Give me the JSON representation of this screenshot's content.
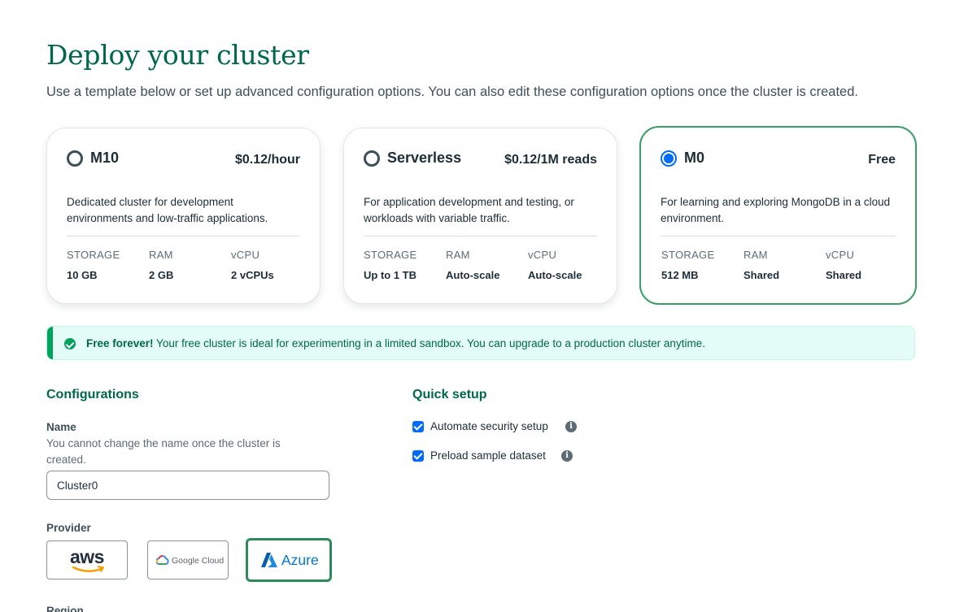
{
  "header": {
    "title": "Deploy your cluster",
    "subtitle": "Use a template below or set up advanced configuration options. You can also edit these configuration options once the cluster is created."
  },
  "tiers": [
    {
      "name": "M10",
      "price": "$0.12/hour",
      "selected": false,
      "description": "Dedicated cluster for development environments and low-traffic applications.",
      "specs": [
        {
          "label": "STORAGE",
          "value": "10 GB"
        },
        {
          "label": "RAM",
          "value": "2 GB"
        },
        {
          "label": "vCPU",
          "value": "2 vCPUs"
        }
      ]
    },
    {
      "name": "Serverless",
      "price": "$0.12/1M reads",
      "selected": false,
      "description": "For application development and testing, or workloads with variable traffic.",
      "specs": [
        {
          "label": "STORAGE",
          "value": "Up to 1 TB"
        },
        {
          "label": "RAM",
          "value": "Auto-scale"
        },
        {
          "label": "vCPU",
          "value": "Auto-scale"
        }
      ]
    },
    {
      "name": "M0",
      "price": "Free",
      "selected": true,
      "description": "For learning and exploring MongoDB in a cloud environment.",
      "specs": [
        {
          "label": "STORAGE",
          "value": "512 MB"
        },
        {
          "label": "RAM",
          "value": "Shared"
        },
        {
          "label": "vCPU",
          "value": "Shared"
        }
      ]
    }
  ],
  "banner": {
    "bold": "Free forever!",
    "text": " Your free cluster is ideal for experimenting in a limited sandbox. You can upgrade to a production cluster anytime."
  },
  "configurations": {
    "title": "Configurations",
    "name_label": "Name",
    "name_help": "You cannot change the name once the cluster is created.",
    "name_value": "Cluster0",
    "provider_label": "Provider",
    "providers": [
      {
        "name": "aws",
        "selected": false
      },
      {
        "name": "Google Cloud",
        "selected": false
      },
      {
        "name": "Azure",
        "selected": true
      }
    ],
    "region_label": "Region"
  },
  "quick_setup": {
    "title": "Quick setup",
    "options": [
      {
        "label": "Automate security setup",
        "checked": true
      },
      {
        "label": "Preload sample dataset",
        "checked": true
      }
    ]
  },
  "colors": {
    "brand_green": "#00684a",
    "selected_border": "#3a9e66",
    "accent_blue": "#016bf8",
    "banner_bg": "#e3fcf7"
  }
}
